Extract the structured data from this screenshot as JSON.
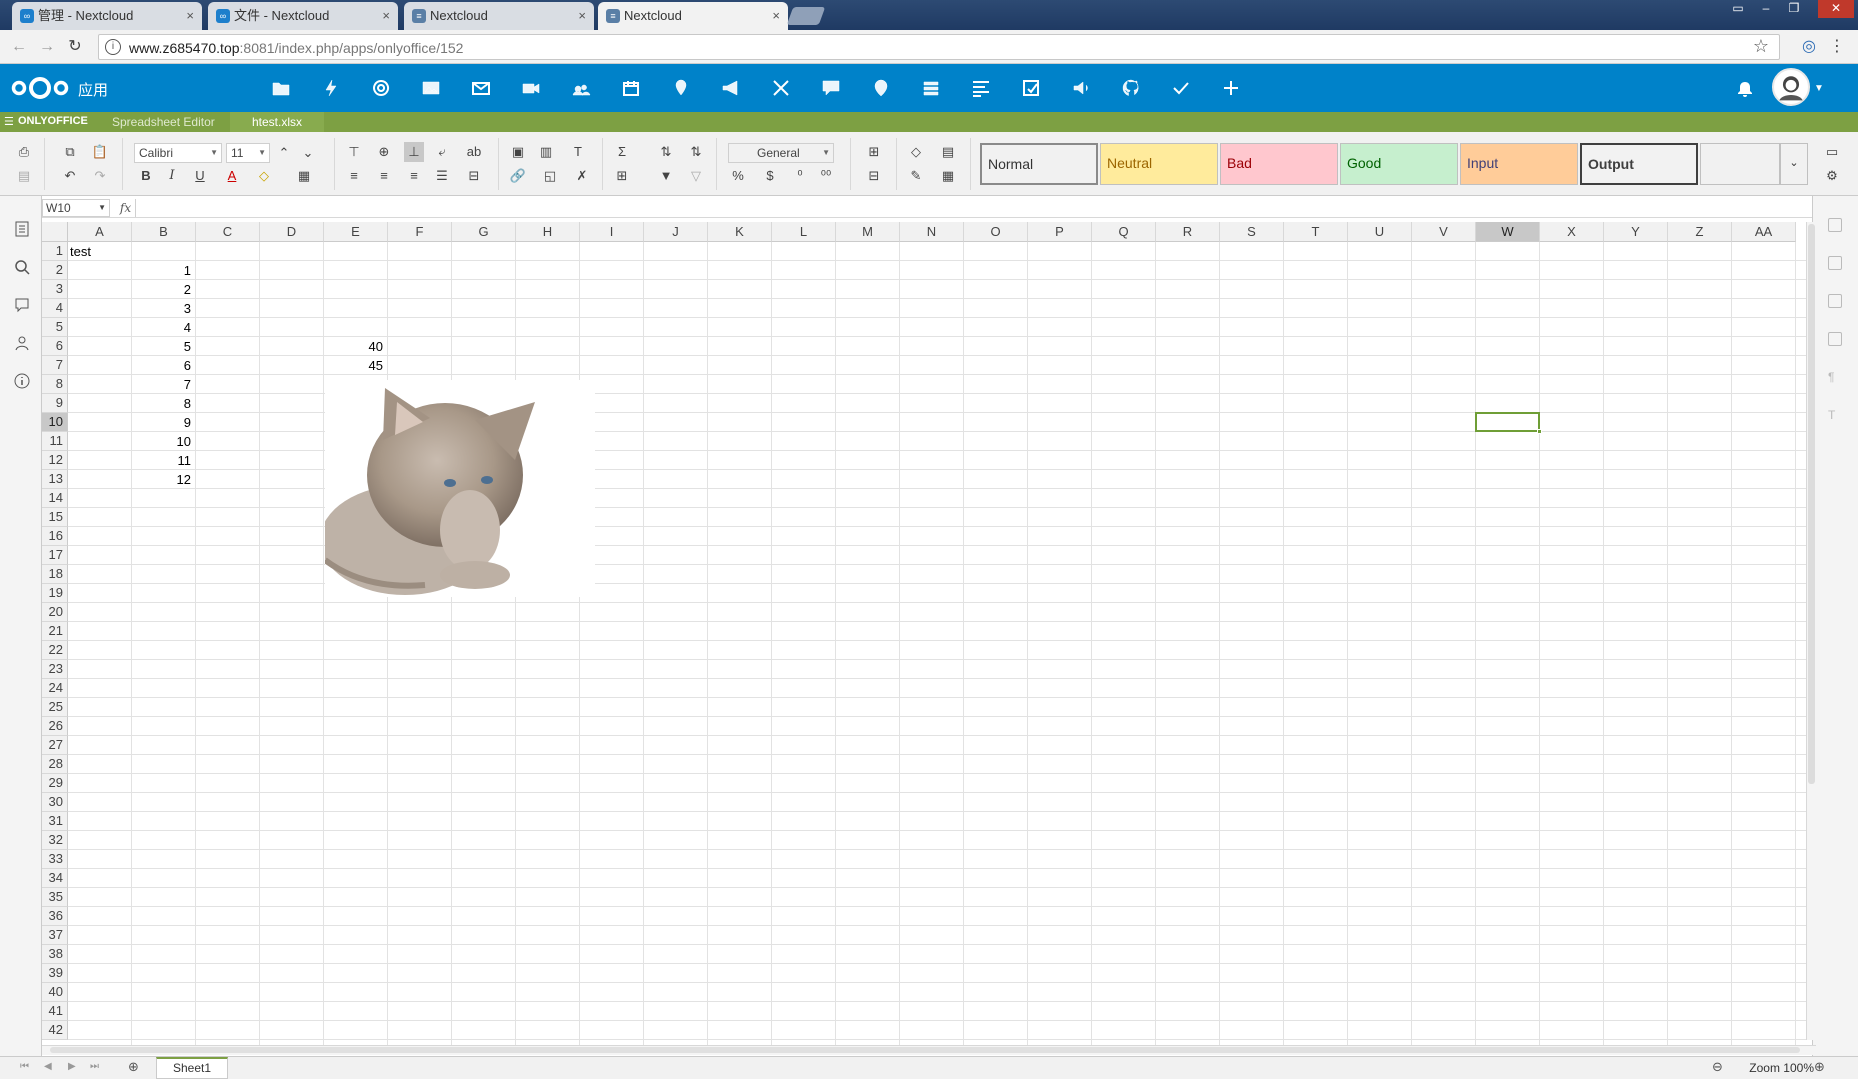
{
  "browser": {
    "tabs": [
      {
        "title": "管理 - Nextcloud",
        "active": false
      },
      {
        "title": "文件 - Nextcloud",
        "active": false
      },
      {
        "title": "Nextcloud",
        "active": false
      },
      {
        "title": "Nextcloud",
        "active": true
      }
    ],
    "url_host": "www.z685470.top",
    "url_rest": ":8081/index.php/apps/onlyoffice/152",
    "tab_close": "×"
  },
  "nextcloud": {
    "apps_label": "应用",
    "brand_color": "#0082c9",
    "app_icons": [
      "folder-icon",
      "activity-icon",
      "gallery-icon",
      "photos-icon",
      "mail-icon",
      "video-icon",
      "contacts-icon",
      "calendar-icon",
      "maps-icon",
      "announcements-icon",
      "transfer-icon",
      "chat-icon",
      "location-icon",
      "deck-icon",
      "tasks-icon",
      "notes-icon",
      "audio-icon",
      "github-icon",
      "check-icon",
      "plus-icon"
    ]
  },
  "onlyoffice": {
    "brand": "ONLYOFFICE",
    "editor_type": "Spreadsheet Editor",
    "file_name": "htest.xlsx",
    "accent_color": "#7da043"
  },
  "toolbar": {
    "font_name": "Calibri",
    "font_size": "11",
    "number_format": "General",
    "styles": [
      {
        "label": "Normal",
        "bg": "#ffffff",
        "fg": "#000000"
      },
      {
        "label": "Neutral",
        "bg": "#ffeb9c",
        "fg": "#9c6500"
      },
      {
        "label": "Bad",
        "bg": "#ffc7ce",
        "fg": "#9c0006"
      },
      {
        "label": "Good",
        "bg": "#c6efce",
        "fg": "#006100"
      },
      {
        "label": "Input",
        "bg": "#ffcc99",
        "fg": "#3f3f76"
      },
      {
        "label": "Output",
        "bg": "#f2f2f2",
        "fg": "#3f3f3f"
      }
    ]
  },
  "formula_bar": {
    "name_box": "W10",
    "fx": "fx",
    "value": ""
  },
  "sheet": {
    "columns": [
      "A",
      "B",
      "C",
      "D",
      "E",
      "F",
      "G",
      "H",
      "I",
      "J",
      "K",
      "L",
      "M",
      "N",
      "O",
      "P",
      "Q",
      "R",
      "S",
      "T",
      "U",
      "V",
      "W",
      "X",
      "Y",
      "Z",
      "AA"
    ],
    "selected_column": "W",
    "selected_row": 10,
    "row_count": 42,
    "cells": [
      {
        "ref": "A1",
        "value": "test",
        "align": "left"
      },
      {
        "ref": "B2",
        "value": "1",
        "align": "right"
      },
      {
        "ref": "B3",
        "value": "2",
        "align": "right"
      },
      {
        "ref": "B4",
        "value": "3",
        "align": "right"
      },
      {
        "ref": "B5",
        "value": "4",
        "align": "right"
      },
      {
        "ref": "B6",
        "value": "5",
        "align": "right"
      },
      {
        "ref": "B7",
        "value": "6",
        "align": "right"
      },
      {
        "ref": "B8",
        "value": "7",
        "align": "right"
      },
      {
        "ref": "B9",
        "value": "8",
        "align": "right"
      },
      {
        "ref": "B10",
        "value": "9",
        "align": "right"
      },
      {
        "ref": "B11",
        "value": "10",
        "align": "right"
      },
      {
        "ref": "B12",
        "value": "11",
        "align": "right"
      },
      {
        "ref": "B13",
        "value": "12",
        "align": "right"
      },
      {
        "ref": "E6",
        "value": "40",
        "align": "right"
      },
      {
        "ref": "E7",
        "value": "45",
        "align": "right"
      }
    ],
    "embedded_image": "kitten-photo"
  },
  "status": {
    "sheet_tab": "Sheet1",
    "zoom": "Zoom 100%"
  }
}
